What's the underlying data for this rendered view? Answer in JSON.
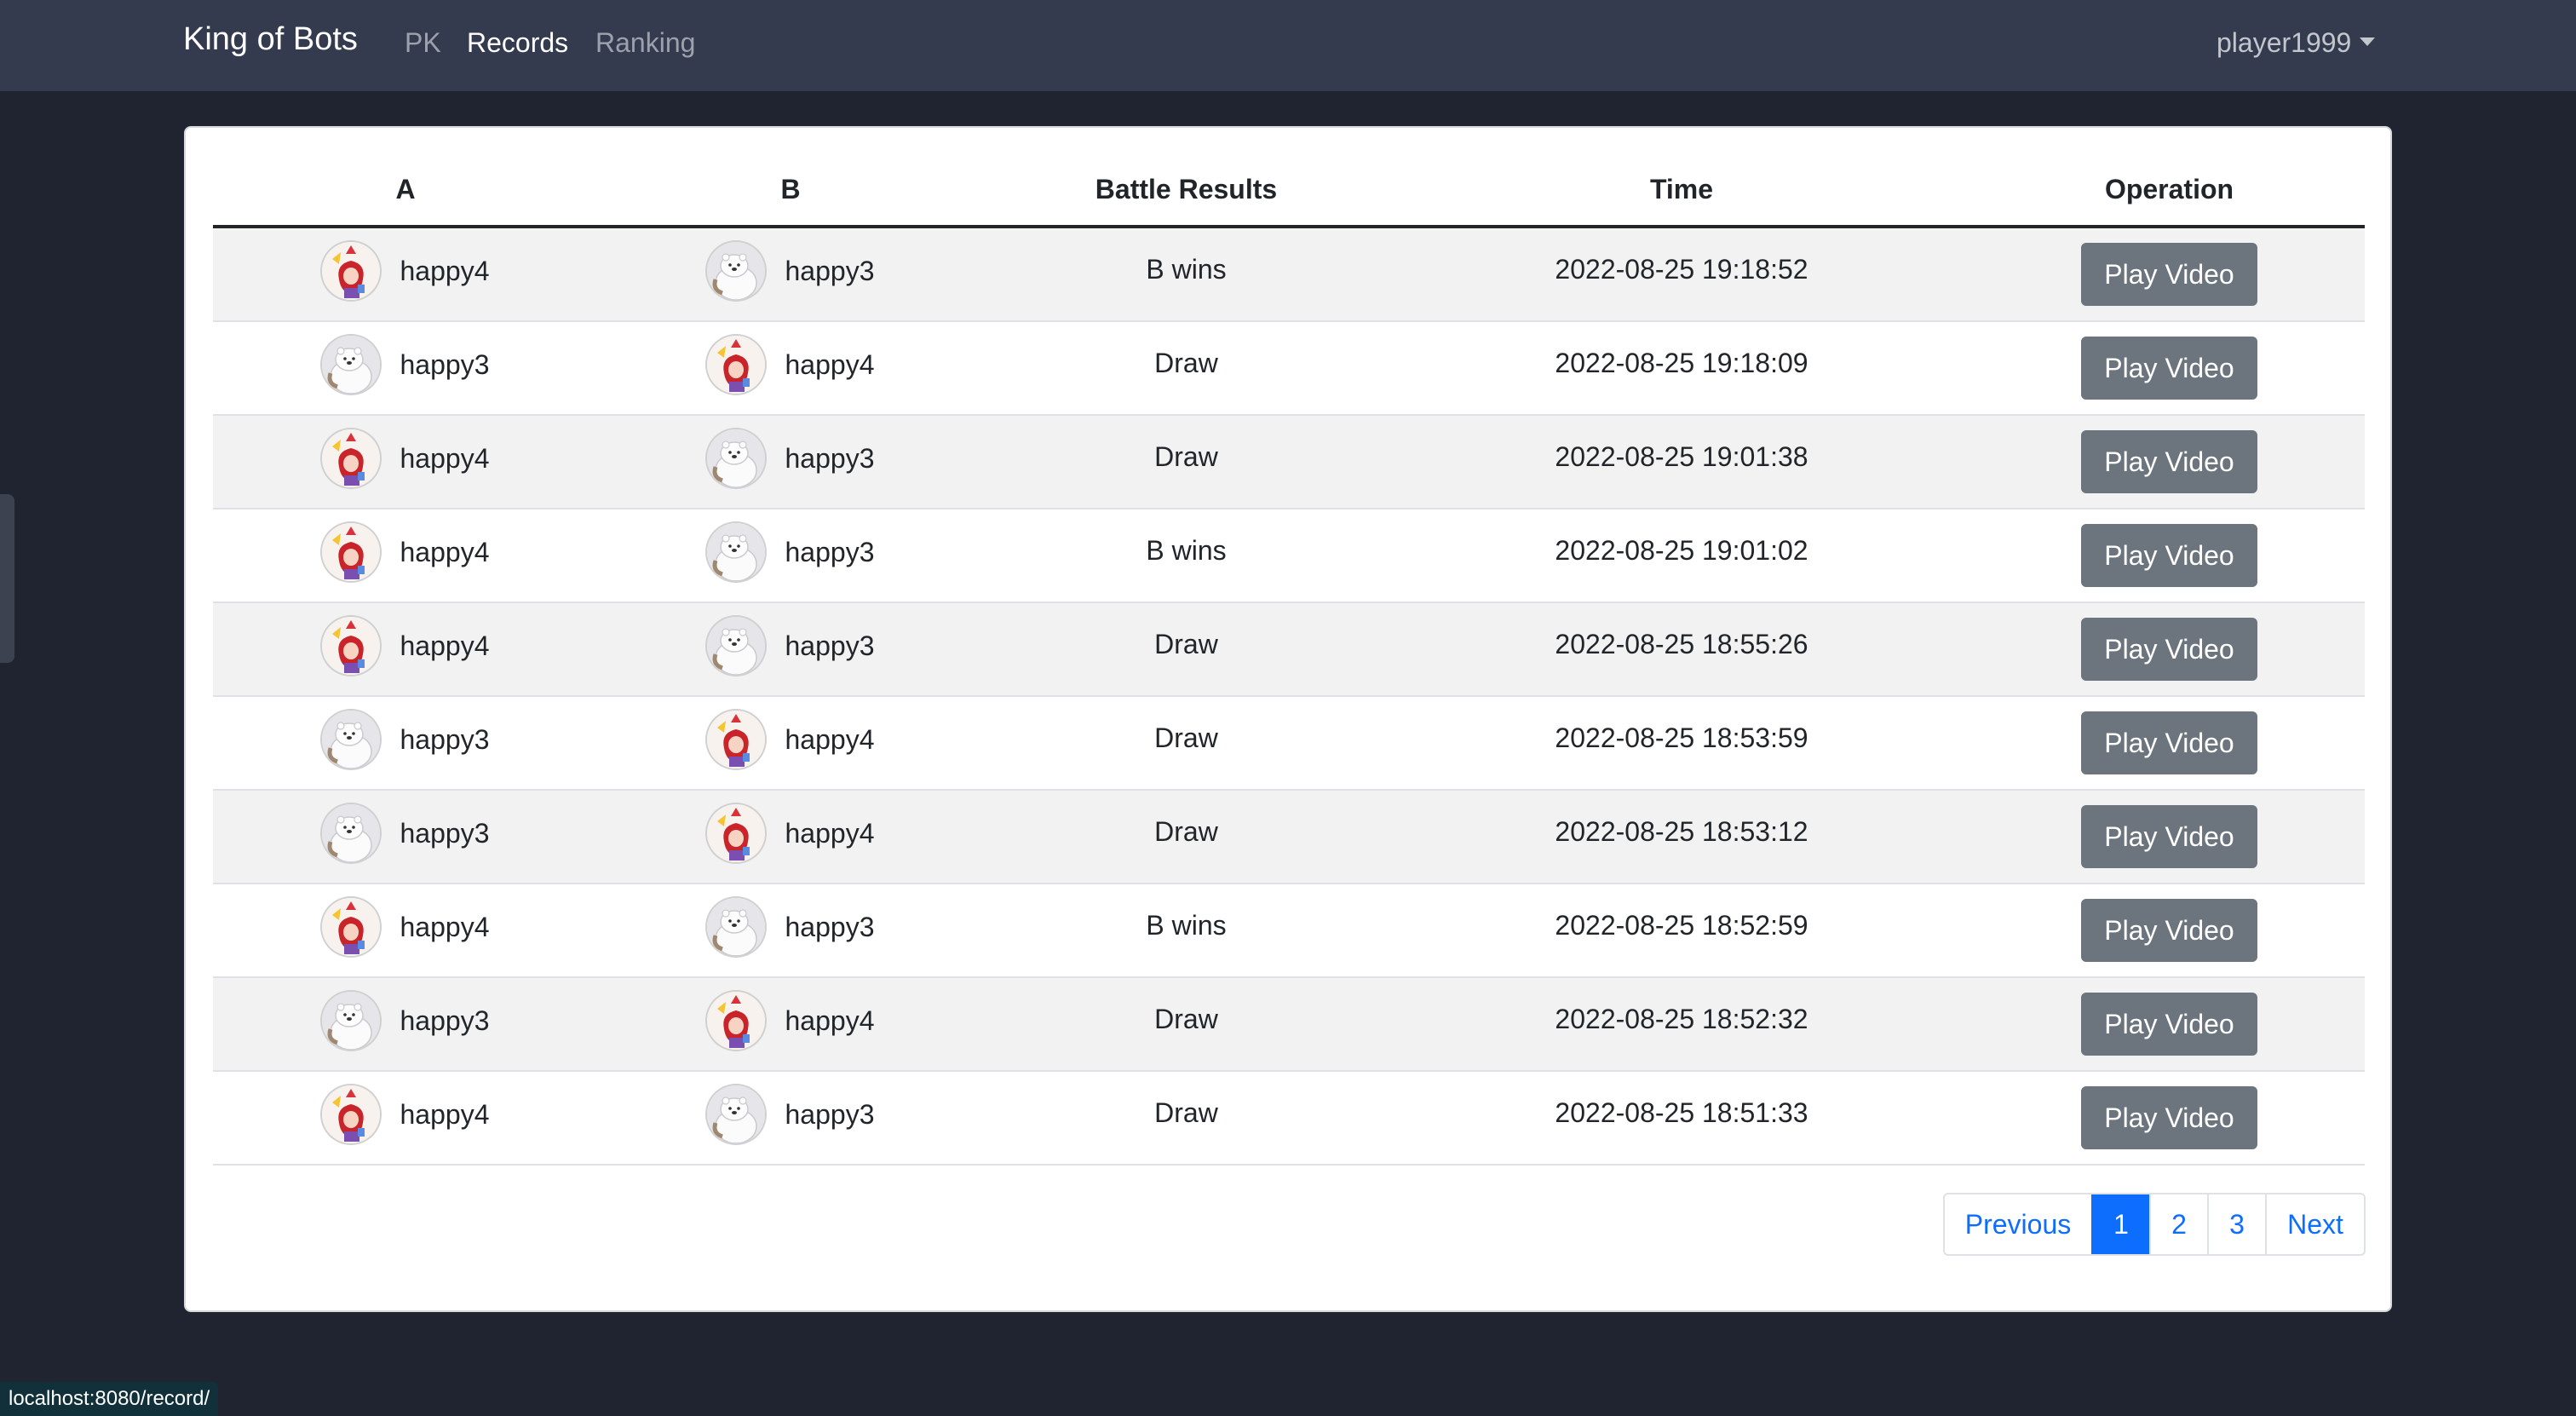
{
  "navbar": {
    "brand": "King of Bots",
    "links": {
      "pk": "PK",
      "records": "Records",
      "ranking": "Ranking"
    },
    "user": "player1999"
  },
  "table": {
    "headers": {
      "a": "A",
      "b": "B",
      "result": "Battle Results",
      "time": "Time",
      "operation": "Operation"
    },
    "rows": [
      {
        "a_avatar": "girl",
        "a_name": "happy4",
        "b_avatar": "bear",
        "b_name": "happy3",
        "result": "B wins",
        "time": "2022-08-25 19:18:52",
        "action": "Play Video"
      },
      {
        "a_avatar": "bear",
        "a_name": "happy3",
        "b_avatar": "girl",
        "b_name": "happy4",
        "result": "Draw",
        "time": "2022-08-25 19:18:09",
        "action": "Play Video"
      },
      {
        "a_avatar": "girl",
        "a_name": "happy4",
        "b_avatar": "bear",
        "b_name": "happy3",
        "result": "Draw",
        "time": "2022-08-25 19:01:38",
        "action": "Play Video"
      },
      {
        "a_avatar": "girl",
        "a_name": "happy4",
        "b_avatar": "bear",
        "b_name": "happy3",
        "result": "B wins",
        "time": "2022-08-25 19:01:02",
        "action": "Play Video"
      },
      {
        "a_avatar": "girl",
        "a_name": "happy4",
        "b_avatar": "bear",
        "b_name": "happy3",
        "result": "Draw",
        "time": "2022-08-25 18:55:26",
        "action": "Play Video"
      },
      {
        "a_avatar": "bear",
        "a_name": "happy3",
        "b_avatar": "girl",
        "b_name": "happy4",
        "result": "Draw",
        "time": "2022-08-25 18:53:59",
        "action": "Play Video"
      },
      {
        "a_avatar": "bear",
        "a_name": "happy3",
        "b_avatar": "girl",
        "b_name": "happy4",
        "result": "Draw",
        "time": "2022-08-25 18:53:12",
        "action": "Play Video"
      },
      {
        "a_avatar": "girl",
        "a_name": "happy4",
        "b_avatar": "bear",
        "b_name": "happy3",
        "result": "B wins",
        "time": "2022-08-25 18:52:59",
        "action": "Play Video"
      },
      {
        "a_avatar": "bear",
        "a_name": "happy3",
        "b_avatar": "girl",
        "b_name": "happy4",
        "result": "Draw",
        "time": "2022-08-25 18:52:32",
        "action": "Play Video"
      },
      {
        "a_avatar": "girl",
        "a_name": "happy4",
        "b_avatar": "bear",
        "b_name": "happy3",
        "result": "Draw",
        "time": "2022-08-25 18:51:33",
        "action": "Play Video"
      }
    ]
  },
  "pagination": {
    "previous": "Previous",
    "pages": [
      "1",
      "2",
      "3"
    ],
    "active": "1",
    "next": "Next"
  },
  "statusbar": {
    "url": "localhost:8080/record/"
  },
  "colors": {
    "background": "#202431",
    "navbar": "#343b4f",
    "button": "#6c757d",
    "link": "#0d6efd"
  }
}
